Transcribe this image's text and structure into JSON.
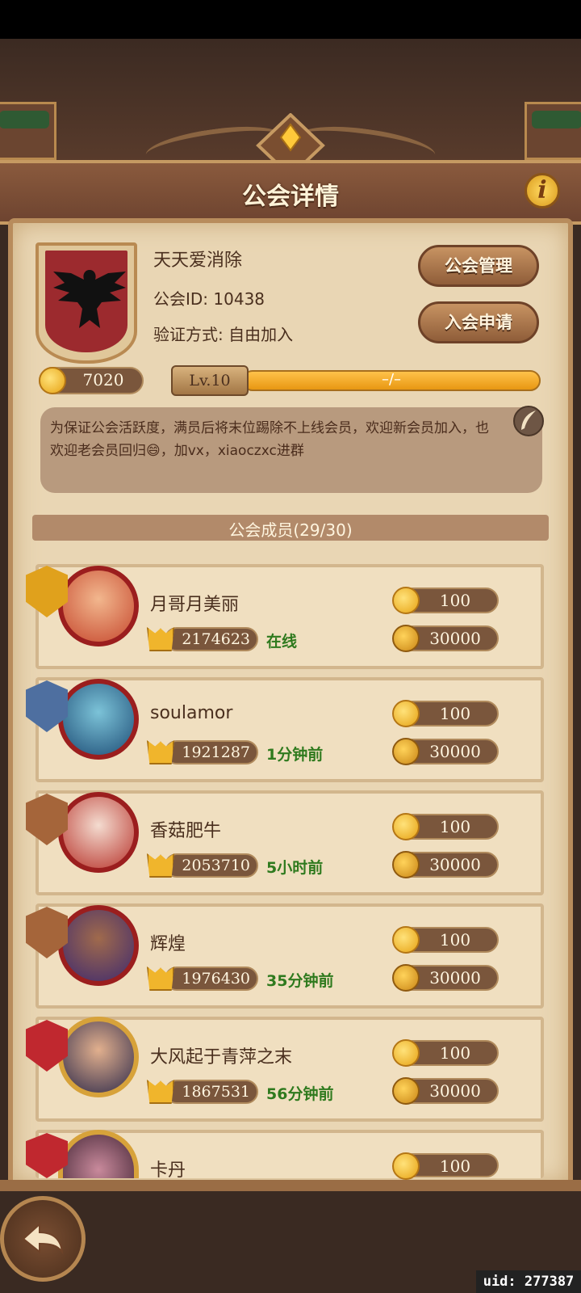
{
  "header": {
    "title": "公会详情",
    "info_label": "i"
  },
  "guild": {
    "name": "天天爱消除",
    "id_text": "公会ID: 10438",
    "verify_text": "验证方式: 自由加入",
    "manage_label": "公会管理",
    "apply_label": "入会申请",
    "funds": "7020",
    "level": "Lv.10",
    "exp_text": "–/–",
    "notice": "为保证公会活跃度，满员后将末位踢除不上线会员，欢迎新会员加入，也欢迎老会员回归😄，加vx，xiaoczxc进群"
  },
  "members_header": "公会成员(29/30)",
  "members": [
    {
      "name": "月哥月美丽",
      "power": "2174623",
      "status": "在线",
      "coins": "100",
      "contribution": "30000"
    },
    {
      "name": "soulamor",
      "power": "1921287",
      "status": "1分钟前",
      "coins": "100",
      "contribution": "30000"
    },
    {
      "name": "香菇肥牛",
      "power": "2053710",
      "status": "5小时前",
      "coins": "100",
      "contribution": "30000"
    },
    {
      "name": "辉煌",
      "power": "1976430",
      "status": "35分钟前",
      "coins": "100",
      "contribution": "30000"
    },
    {
      "name": "大风起于青萍之末",
      "power": "1867531",
      "status": "56分钟前",
      "coins": "100",
      "contribution": "30000"
    },
    {
      "name": "卡丹",
      "coins": "100"
    }
  ],
  "colors": {
    "panel": "#e9d6b4",
    "frame": "#b88c5c",
    "status_green": "#2f7a1e",
    "rank_gold": "#e0a11c",
    "rank_silver": "#4e6fa0",
    "rank_bronze": "#a5653a",
    "rank_red": "#c0282f"
  },
  "uid_text": "uid: 277387"
}
